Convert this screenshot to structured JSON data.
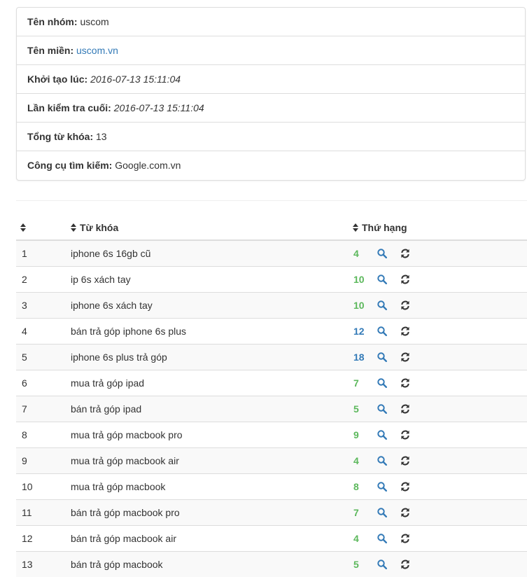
{
  "group_info": {
    "group_name_label": "Tên nhóm:",
    "group_name_value": "uscom",
    "domain_label": "Tên miền:",
    "domain_value": "uscom.vn",
    "created_label": "Khởi tạo lúc:",
    "created_value": "2016-07-13 15:11:04",
    "last_check_label": "Lần kiểm tra cuối:",
    "last_check_value": "2016-07-13 15:11:04",
    "total_keywords_label": "Tổng từ khóa:",
    "total_keywords_value": "13",
    "search_engine_label": "Công cụ tìm kiếm:",
    "search_engine_value": "Google.com.vn"
  },
  "table": {
    "headers": {
      "number": "",
      "keyword": "Từ khóa",
      "rank": "Thứ hạng"
    },
    "rank_colors": {
      "top10": "#5cb85c",
      "beyond10": "#337ab7"
    },
    "icons": {
      "sort": "sort-icon",
      "view": "search-icon",
      "refresh": "refresh-icon"
    },
    "rows": [
      {
        "num": "1",
        "keyword": "iphone 6s 16gb cũ",
        "rank": "4"
      },
      {
        "num": "2",
        "keyword": "ip 6s xách tay",
        "rank": "10"
      },
      {
        "num": "3",
        "keyword": "iphone 6s xách tay",
        "rank": "10"
      },
      {
        "num": "4",
        "keyword": "bán trả góp iphone 6s plus",
        "rank": "12"
      },
      {
        "num": "5",
        "keyword": "iphone 6s plus trả góp",
        "rank": "18"
      },
      {
        "num": "6",
        "keyword": "mua trả góp ipad",
        "rank": "7"
      },
      {
        "num": "7",
        "keyword": "bán trả góp ipad",
        "rank": "5"
      },
      {
        "num": "8",
        "keyword": "mua trả góp macbook pro",
        "rank": "9"
      },
      {
        "num": "9",
        "keyword": "mua trả góp macbook air",
        "rank": "4"
      },
      {
        "num": "10",
        "keyword": "mua trả góp macbook",
        "rank": "8"
      },
      {
        "num": "11",
        "keyword": "bán trả góp macbook pro",
        "rank": "7"
      },
      {
        "num": "12",
        "keyword": "bán trả góp macbook air",
        "rank": "4"
      },
      {
        "num": "13",
        "keyword": "bán trả góp macbook",
        "rank": "5"
      }
    ]
  }
}
